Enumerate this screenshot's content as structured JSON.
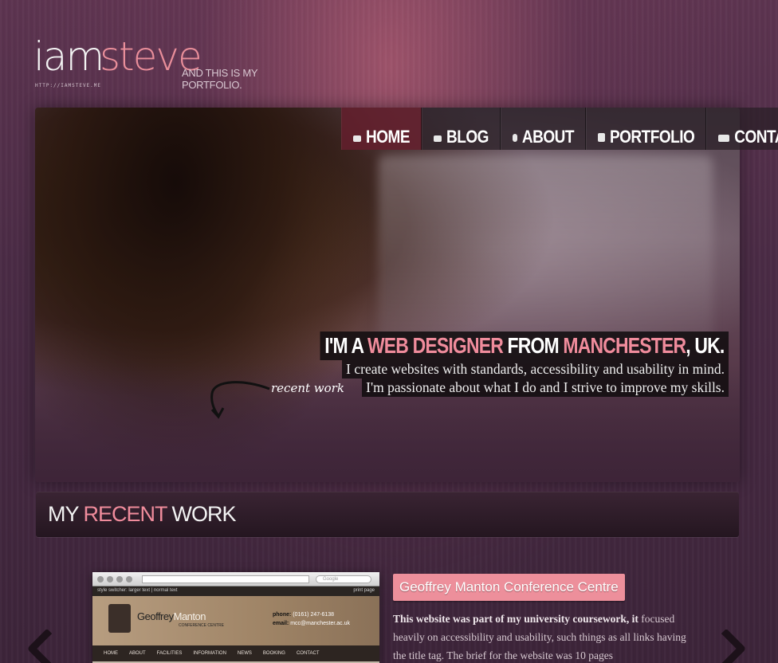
{
  "logo": {
    "iam": "iam",
    "steve": "steve",
    "tagline": "AND THIS IS MY PORTFOLIO.",
    "url": "HTTP://IAMSTEVE.ME"
  },
  "nav": {
    "items": [
      {
        "label": "HOME",
        "icon": "home-icon",
        "active": true
      },
      {
        "label": "BLOG",
        "icon": "speech-bubble-icon"
      },
      {
        "label": "ABOUT",
        "icon": "person-icon"
      },
      {
        "label": "PORTFOLIO",
        "icon": "document-icon"
      },
      {
        "label": "CONTACT",
        "icon": "envelope-icon"
      }
    ]
  },
  "intro": {
    "headline_a": "I'M A ",
    "headline_b": "WEB DESIGNER",
    "headline_c": " FROM ",
    "headline_d": "MANCHESTER",
    "headline_e": ", UK.",
    "line1": "I create websites with standards, accessibility and usability in mind.",
    "line2": "I'm passionate about what I do and I strive to improve my skills."
  },
  "recent_link": "recent work",
  "section": {
    "word1": "MY",
    "word2": "RECENT",
    "word3": "WORK"
  },
  "project": {
    "title": "Geoffrey Manton Conference Centre",
    "desc_bold": "This website was part of my university coursework, it",
    "desc_rest": "focused heavily on accessibility and usability, such things as all links having the title tag. The brief for the website was 10 pages",
    "screenshot": {
      "search_placeholder": "Google",
      "style_switcher": "style switcher: larger text | normal text",
      "print": "print page",
      "name_a": "Geoffrey",
      "name_b": "Manton",
      "subtitle": "CONFERENCE CENTRE",
      "phone_label": "phone:",
      "phone": "(0161) 247-6138",
      "email_label": "email:",
      "email": "mcc@manchester.ac.uk",
      "menu": [
        "HOME",
        "ABOUT",
        "FACILITIES",
        "INFORMATION",
        "NEWS",
        "BOOKING",
        "CONTACT"
      ]
    }
  },
  "colors": {
    "accent": "#ed8f9b",
    "background": "#4a2b45"
  }
}
